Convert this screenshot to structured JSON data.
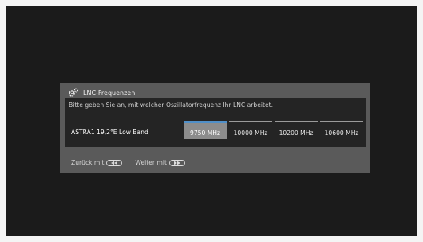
{
  "dialog": {
    "title": "LNC-Frequenzen",
    "title_icon": "gear-icon",
    "prompt": "Bitte geben Sie an, mit welcher Oszillatorfrequenz Ihr LNC arbeitet.",
    "satellite_label": "ASTRA1 19,2°E Low Band",
    "frequencies": [
      "9750 MHz",
      "10000 MHz",
      "10200 MHz",
      "10600 MHz"
    ],
    "selected_frequency": "9750 MHz"
  },
  "footer": {
    "back_label": "Zurück mit",
    "back_icon": "rewind-button-icon",
    "next_label": "Weiter mit",
    "next_icon": "fast-forward-button-icon"
  },
  "colors": {
    "screen_bg": "#1b1b1b",
    "dialog_bg": "#5a5a5a",
    "panel_bg": "#242424",
    "selected_bg": "#8c8c8c",
    "accent": "#4f8fc8"
  }
}
